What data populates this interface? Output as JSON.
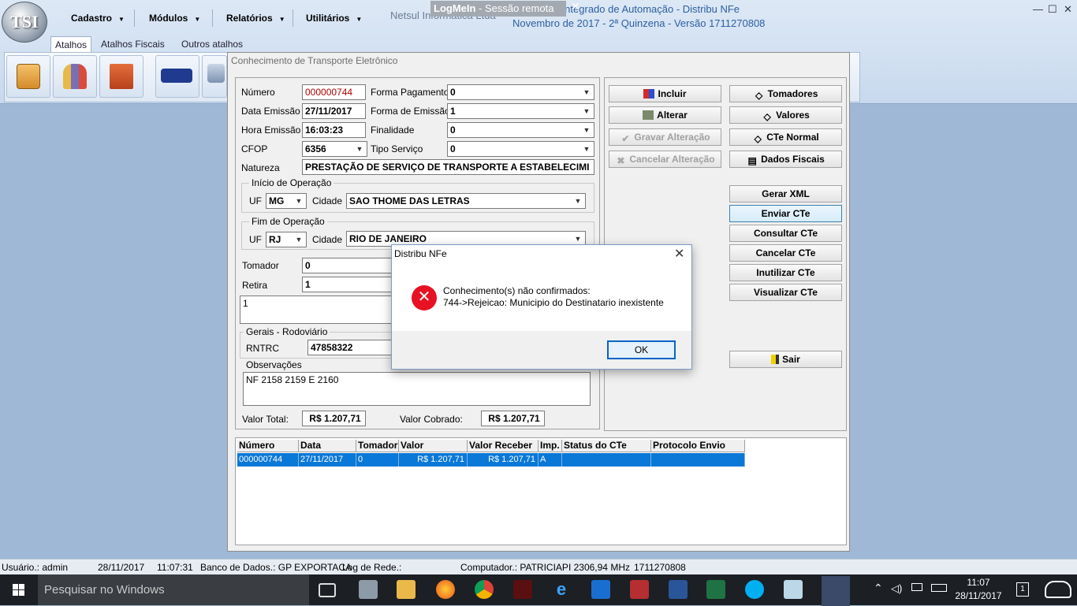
{
  "app": {
    "logo_text": "TSI",
    "menus": [
      "Cadastro",
      "Módulos",
      "Relatórios",
      "Utilitários"
    ],
    "company": "Netsul Informática Ltda -",
    "title_line1": "Sistema Integrado de Automação - Distribu NFe",
    "title_line2": "Novembro de 2017 - 2ª Quinzena - Versão 1711270808",
    "logmein_brand": "LogMeIn",
    "logmein_rest": " - Sessão remota",
    "ribbon_tabs": [
      "Atalhos",
      "Atalhos Fiscais",
      "Outros atalhos"
    ],
    "shortcut_icons": [
      "grocery-bag-icon",
      "people-icon",
      "factory-icon",
      "truck-icon",
      "cart-icon"
    ]
  },
  "window": {
    "title": "Conhecimento de Transporte Eletrônico",
    "form": {
      "numero_label": "Número",
      "numero": "000000744",
      "data_label": "Data Emissão",
      "data": "27/11/2017",
      "hora_label": "Hora Emissão",
      "hora": "16:03:23",
      "cfop_label": "CFOP",
      "cfop": "6356",
      "natureza_label": "Natureza",
      "natureza": "PRESTAÇÃO DE SERVIÇO DE TRANSPORTE A ESTABELECIMI",
      "forma_pag_label": "Forma Pagamento",
      "forma_pag": "0",
      "forma_emi_label": "Forma de Emissão",
      "forma_emi": "1",
      "finalidade_label": "Finalidade",
      "finalidade": "0",
      "tipo_servico_label": "Tipo Serviço",
      "tipo_servico": "0",
      "inicio_title": "Início de Operação",
      "inicio_uf": "MG",
      "inicio_cidade": "SAO THOME DAS LETRAS",
      "fim_title": "Fim de Operação",
      "fim_uf": "RJ",
      "fim_cidade": "RIO DE JANEIRO",
      "uf_label": "UF",
      "cidade_label": "Cidade",
      "tomador_label": "Tomador",
      "tomador": "0",
      "retira_label": "Retira",
      "retira": "1",
      "memo": "1",
      "gerais_title": "Gerais - Rodoviário",
      "rntrc_label": "RNTRC",
      "rntrc": "47858322",
      "obs_title": "Observações",
      "obs": "NF 2158 2159 E 2160",
      "valor_total_label": "Valor Total:",
      "valor_total": "R$ 1.207,71",
      "valor_cobrado_label": "Valor Cobrado:",
      "valor_cobrado": "R$ 1.207,71"
    },
    "buttons": {
      "incluir": "Incluir",
      "alterar": "Alterar",
      "gravar": "Gravar Alteração",
      "cancelar_alt": "Cancelar Alteração",
      "tomadores": "Tomadores",
      "valores": "Valores",
      "cte_normal": "CTe Normal",
      "dados_fiscais": "Dados Fiscais",
      "gerar_xml": "Gerar XML",
      "enviar": "Enviar CTe",
      "consultar": "Consultar CTe",
      "cancelar": "Cancelar CTe",
      "inutilizar": "Inutilizar CTe",
      "visualizar": "Visualizar CTe",
      "sair": "Sair"
    },
    "grid": {
      "headers": [
        "Número",
        "Data",
        "Tomador",
        "Valor",
        "Valor Receber",
        "Imp.",
        "Status do CTe",
        "Protocolo Envio"
      ],
      "row": [
        "000000744",
        "27/11/2017",
        "0",
        "R$ 1.207,71",
        "R$ 1.207,71",
        "A",
        "",
        ""
      ]
    }
  },
  "dialog": {
    "title": "Distribu NFe",
    "line1": "Conhecimento(s) não confirmados:",
    "line2": "744->Rejeicao: Municipio do Destinatario inexistente",
    "ok": "OK"
  },
  "status": {
    "usuario": "Usuário.: admin",
    "data": "28/11/2017",
    "hora": "11:07:31",
    "banco": "Banco de Dados.: GP EXPORTACA",
    "log": "Log de Rede.:",
    "computador": "Computador.: PATRICIAPI 2306,94 MHz",
    "versao": "1711270808"
  },
  "taskbar": {
    "search": "Pesquisar no Windows",
    "time": "11:07",
    "date": "28/11/2017",
    "notif_count": "1"
  }
}
